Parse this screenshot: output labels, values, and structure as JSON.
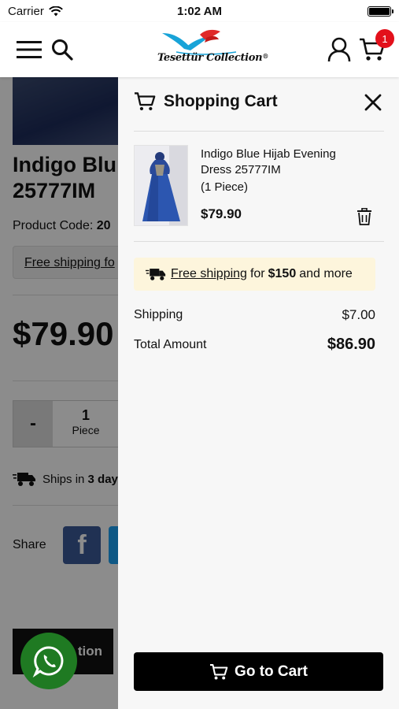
{
  "status_bar": {
    "carrier": "Carrier",
    "time": "1:02 AM"
  },
  "header": {
    "logo_text": "Tesettür Collection",
    "logo_mark": "®",
    "cart_count": "1"
  },
  "background_page": {
    "title": "Indigo Blu\n25777IM",
    "product_code_label": "Product Code: ",
    "product_code_value": "20",
    "free_shipping_text": "Free shipping",
    "free_shipping_tail": " fo",
    "price": "$79.90",
    "qty_minus": "-",
    "qty_value": "1",
    "qty_unit": "Piece",
    "ships_text": "Ships in ",
    "ships_days": "3 day",
    "share_label": "Share",
    "action_button": "tion"
  },
  "cart": {
    "title": "Shopping Cart",
    "item": {
      "name": "Indigo Blue Hijab Evening Dress 25777IM",
      "quantity": "(1 Piece)",
      "price": "$79.90"
    },
    "promo": {
      "link": "Free shipping",
      "pre": "for",
      "amount": "$150",
      "post": "and more"
    },
    "shipping_label": "Shipping",
    "shipping_value": "$7.00",
    "total_label": "Total Amount",
    "total_value": "$86.90",
    "go_button": "Go to Cart"
  },
  "colors": {
    "badge": "#e3101b",
    "promo_bg": "#fdf5dc",
    "button": "#000000",
    "whatsapp": "#1f7a22"
  },
  "icons": [
    "wifi-icon",
    "battery-icon",
    "menu-icon",
    "search-icon",
    "user-icon",
    "cart-icon",
    "close-icon",
    "trash-icon",
    "truck-icon",
    "whatsapp-icon",
    "facebook-icon"
  ]
}
